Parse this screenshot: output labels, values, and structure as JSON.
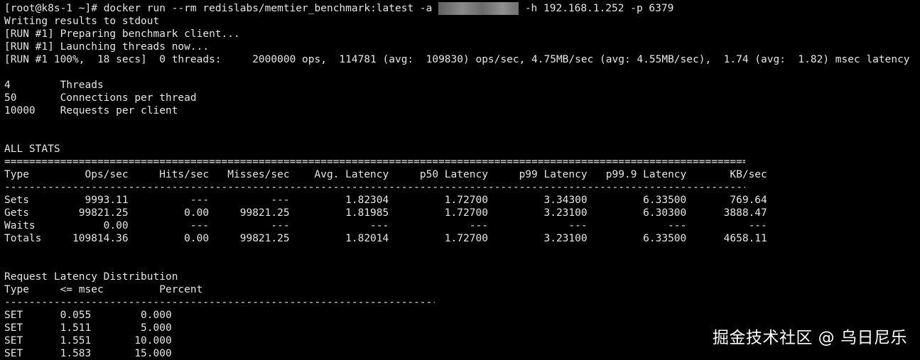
{
  "command": {
    "prompt": "[root@k8s-1 ~]# ",
    "cmd_before": "docker run --rm redislabs/memtier_benchmark:latest -a ",
    "cmd_after": " -h 192.168.1.252 -p 6379"
  },
  "output": {
    "l1": "Writing results to stdout",
    "l2": "[RUN #1] Preparing benchmark client...",
    "l3": "[RUN #1] Launching threads now...",
    "l4": "[RUN #1 100%,  18 secs]  0 threads:     2000000 ops,  114781 (avg:  109830) ops/sec, 4.75MB/sec (avg: 4.55MB/sec),  1.74 (avg:  1.82) msec latency"
  },
  "config": [
    "4        Threads",
    "50       Connections per thread",
    "10000    Requests per client"
  ],
  "all_stats": {
    "title": "ALL STATS",
    "separator_double": "=================================================================================================================================================",
    "separator_single": "-------------------------------------------------------------------------------------------------------------------------------------------------",
    "header": "Type         Ops/sec     Hits/sec   Misses/sec    Avg. Latency     p50 Latency     p99 Latency   p99.9 Latency       KB/sec",
    "rows": [
      "Sets         9993.11          ---          ---         1.82304         1.72700         3.34300         6.33500       769.64",
      "Gets        99821.25         0.00     99821.25         1.81985         1.72700         3.23100         6.30300      3888.47",
      "Waits           0.00          ---          ---             ---             ---             ---             ---          ---",
      "Totals     109814.36         0.00     99821.25         1.82014         1.72700         3.23100         6.33500      4658.11"
    ]
  },
  "latency_dist": {
    "title": "Request Latency Distribution",
    "header": "Type     <= msec         Percent",
    "separator": "------------------------------------------------------------------------------------------------",
    "rows": [
      "SET      0.055        0.000",
      "SET      1.511        5.000",
      "SET      1.551       10.000",
      "SET      1.583       15.000"
    ]
  },
  "watermark": "掘金技术社区 @ 乌日尼乐"
}
